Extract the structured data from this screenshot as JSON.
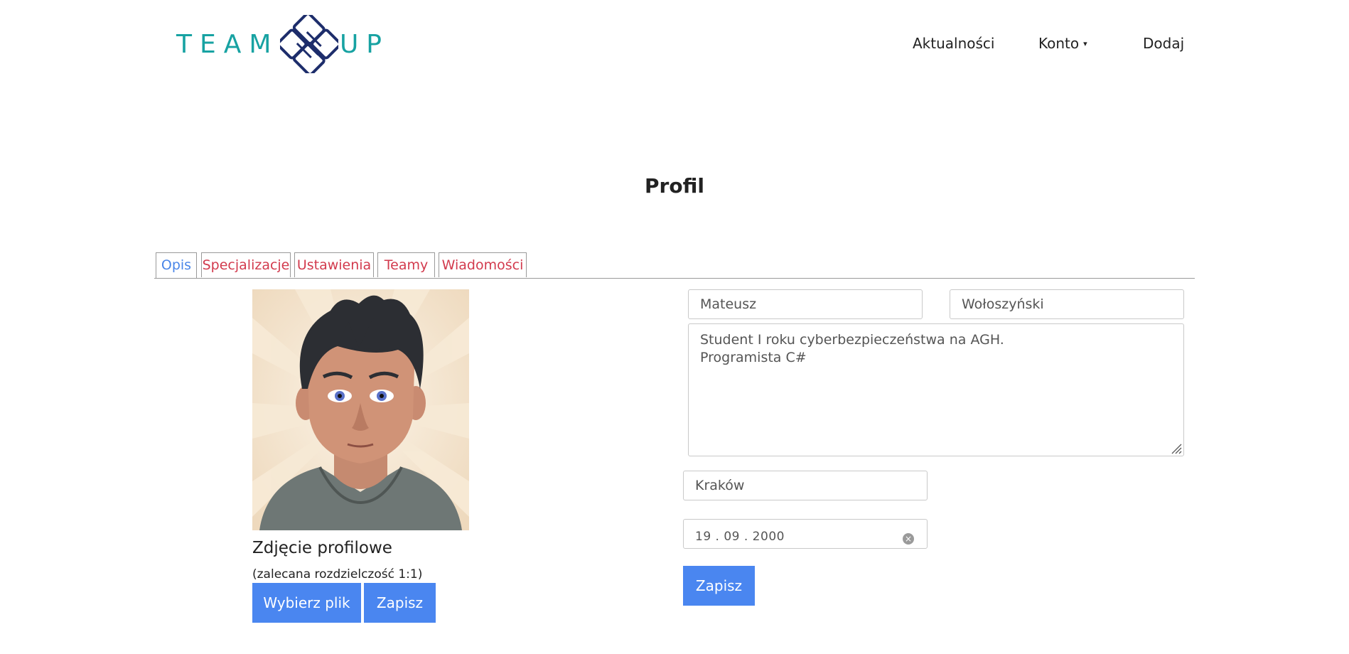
{
  "header": {
    "logo_left": "TEAM",
    "logo_right": "UP",
    "nav": [
      {
        "label": "Aktualności"
      },
      {
        "label": "Konto",
        "caret": "▾"
      },
      {
        "label": "Dodaj"
      }
    ]
  },
  "page": {
    "title": "Profil"
  },
  "tabs": [
    {
      "label": "Opis",
      "active": true
    },
    {
      "label": "Specjalizacje"
    },
    {
      "label": "Ustawienia"
    },
    {
      "label": "Teamy"
    },
    {
      "label": "Wiadomości"
    }
  ],
  "photo": {
    "title": "Zdjęcie profilowe",
    "note": "(zalecana rozdzielczość 1:1)",
    "choose_label": "Wybierz plik",
    "save_label": "Zapisz"
  },
  "form": {
    "first_name": "Mateusz",
    "last_name": "Wołoszyński",
    "description": "Student I roku cyberbezpieczeństwa na AGH.\nProgramista C#",
    "city": "Kraków",
    "birth_date": "19 . 09 . 2000",
    "clear_icon": "×",
    "save_label": "Zapisz"
  },
  "colors": {
    "brand_teal": "#17a2a2",
    "brand_navy": "#1d2d6b",
    "active_tab": "#4a86e8",
    "inactive_tab": "#d23a4d",
    "button": "#4a86f0"
  }
}
